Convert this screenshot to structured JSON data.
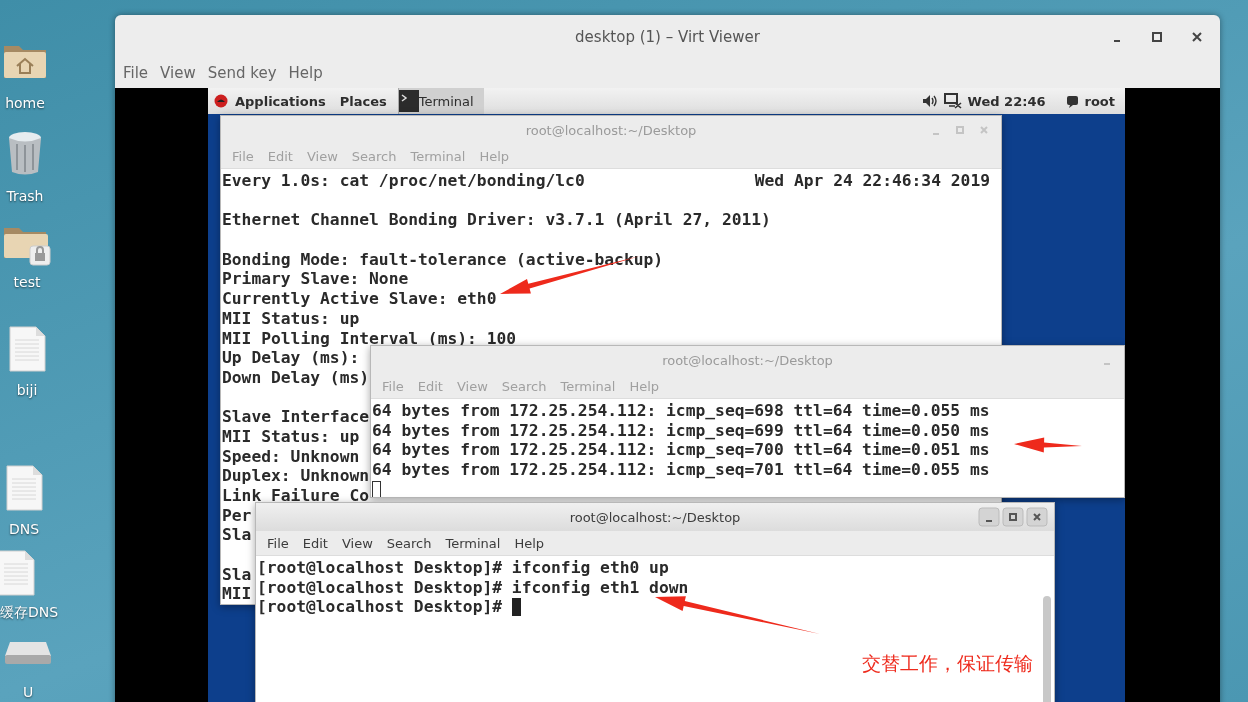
{
  "desktop_icons": [
    {
      "label": "home",
      "kind": "home"
    },
    {
      "label": "Trash",
      "kind": "trash"
    },
    {
      "label": "test",
      "kind": "locked-folder"
    },
    {
      "label": "biji",
      "kind": "document"
    },
    {
      "label": "DNS",
      "kind": "document"
    },
    {
      "label": "缓存DNS",
      "kind": "document"
    },
    {
      "label": "U",
      "kind": "drive"
    }
  ],
  "viewer": {
    "title": "desktop (1) – Virt Viewer",
    "menu": [
      "File",
      "View",
      "Send key",
      "Help"
    ],
    "top_bar": {
      "applications": "Applications",
      "places": "Places",
      "task": "Terminal",
      "clock": "Wed 22:46",
      "user": "root"
    },
    "terminals": [
      {
        "title": "root@localhost:~/Desktop",
        "active": false,
        "menu": [
          "File",
          "Edit",
          "View",
          "Search",
          "Terminal",
          "Help"
        ],
        "clock": "Wed Apr 24 22:46:34 2019",
        "lines": [
          {
            "text": "Every 1.0s: cat /proc/net/bonding/lc0"
          },
          {
            "text": "Ethernet Channel Bonding Driver: v3.7.1 (April 27, 2011)",
            "blank_before": true
          },
          {
            "text": "Bonding Mode: fault-tolerance (active-backup)",
            "blank_before": true
          },
          {
            "text": "Primary Slave: None"
          },
          {
            "text": "Currently Active Slave: eth0"
          },
          {
            "text": "MII Status: up"
          },
          {
            "text": "MII Polling Interval (ms): 100"
          },
          {
            "text": "Up Delay (ms):"
          },
          {
            "text": "Down Delay (ms)"
          },
          {
            "text": "Slave Interface",
            "blank_before": true
          },
          {
            "text": "MII Status: up"
          },
          {
            "text": "Speed: Unknown"
          },
          {
            "text": "Duplex: Unknown"
          },
          {
            "text": "Link Failure Co"
          },
          {
            "text": "Per"
          },
          {
            "text": "Sla"
          },
          {
            "text": "Sla",
            "blank_before": true
          },
          {
            "text": "MII"
          }
        ]
      },
      {
        "title": "root@localhost:~/Desktop",
        "active": false,
        "menu": [
          "File",
          "Edit",
          "View",
          "Search",
          "Terminal",
          "Help"
        ],
        "cursor_own_line": true,
        "lines": [
          {
            "text": "64 bytes from 172.25.254.112: icmp_seq=698 ttl=64 time=0.055 ms"
          },
          {
            "text": "64 bytes from 172.25.254.112: icmp_seq=699 ttl=64 time=0.050 ms"
          },
          {
            "text": "64 bytes from 172.25.254.112: icmp_seq=700 ttl=64 time=0.051 ms"
          },
          {
            "text": "64 bytes from 172.25.254.112: icmp_seq=701 ttl=64 time=0.055 ms"
          }
        ]
      },
      {
        "title": "root@localhost:~/Desktop",
        "active": true,
        "menu": [
          "File",
          "Edit",
          "View",
          "Search",
          "Terminal",
          "Help"
        ],
        "cursor_own_line": false,
        "lines": [
          {
            "text": "[root@localhost Desktop]# ifconfig eth0 up"
          },
          {
            "text": "[root@localhost Desktop]# ifconfig eth1 down"
          },
          {
            "text": "[root@localhost Desktop]# "
          }
        ]
      }
    ]
  },
  "annotation": {
    "note": "交替工作，保证传输"
  }
}
